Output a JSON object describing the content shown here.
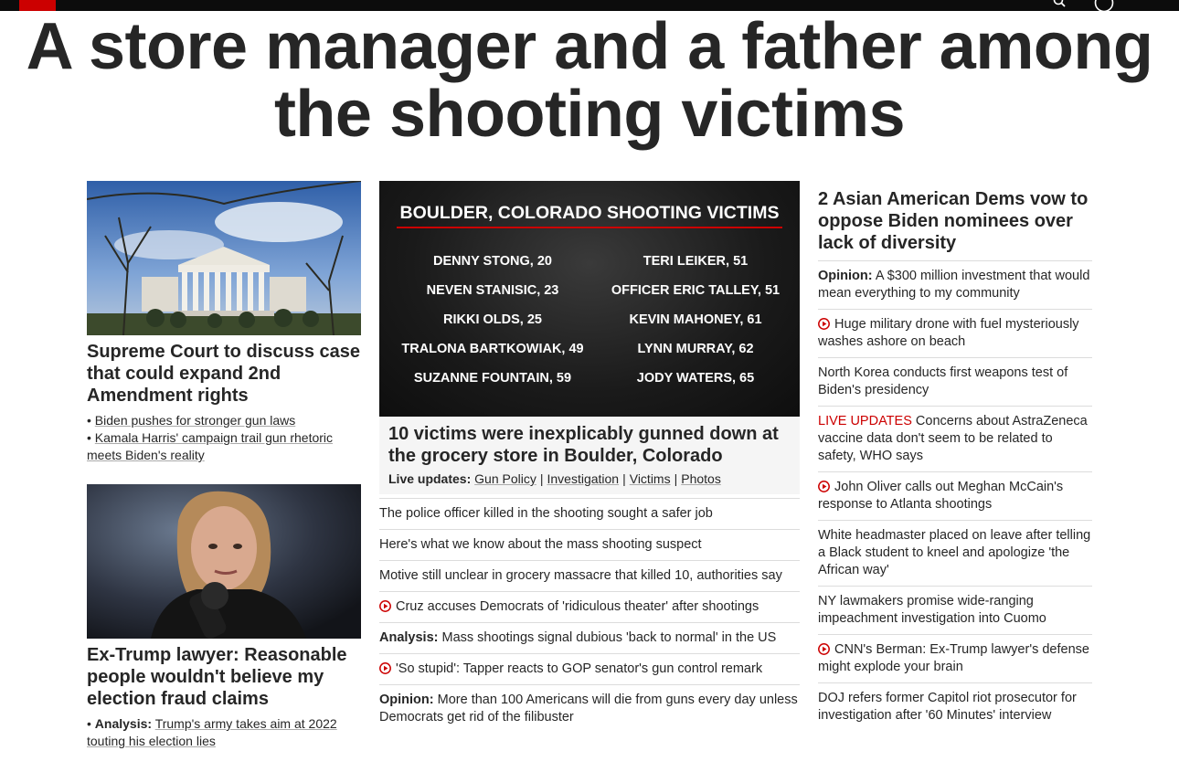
{
  "headline": "A store manager and a father among the shooting victims",
  "left": {
    "story1": {
      "title": "Supreme Court to discuss case that could expand 2nd Amendment rights",
      "links": [
        {
          "prefix": "",
          "text": "Biden pushes for stronger gun laws"
        },
        {
          "prefix": "",
          "text": "Kamala Harris' campaign trail gun rhetoric meets Biden's reality"
        }
      ]
    },
    "story2": {
      "title": "Ex-Trump lawyer: Reasonable people wouldn't believe my election fraud claims",
      "links": [
        {
          "prefix": "Analysis:",
          "text": "Trump's army takes aim at 2022 touting his election lies"
        }
      ]
    }
  },
  "middle": {
    "graphic": {
      "title": "BOULDER, COLORADO SHOOTING VICTIMS",
      "left_names": [
        "DENNY STONG, 20",
        "NEVEN STANISIC, 23",
        "RIKKI OLDS, 25",
        "TRALONA BARTKOWIAK, 49",
        "SUZANNE FOUNTAIN, 59"
      ],
      "right_names": [
        "TERI LEIKER, 51",
        "OFFICER ERIC TALLEY, 51",
        "KEVIN MAHONEY, 61",
        "LYNN MURRAY, 62",
        "JODY WATERS, 65"
      ]
    },
    "lead_title": "10 victims were inexplicably gunned down at the grocery store in Boulder, Colorado",
    "live_label": "Live updates:",
    "live_links": [
      "Gun Policy",
      "Investigation",
      "Victims",
      "Photos"
    ],
    "list": [
      {
        "prefix": "",
        "video": false,
        "text": "The police officer killed in the shooting sought a safer job"
      },
      {
        "prefix": "",
        "video": false,
        "text": "Here's what we know about the mass shooting suspect"
      },
      {
        "prefix": "",
        "video": false,
        "text": "Motive still unclear in grocery massacre that killed 10, authorities say"
      },
      {
        "prefix": "",
        "video": true,
        "text": "Cruz accuses Democrats of 'ridiculous theater' after shootings"
      },
      {
        "prefix": "Analysis:",
        "video": false,
        "text": "Mass shootings signal dubious 'back to normal' in the US"
      },
      {
        "prefix": "",
        "video": true,
        "text": "'So stupid': Tapper reacts to GOP senator's gun control remark"
      },
      {
        "prefix": "Opinion:",
        "video": false,
        "text": "More than 100 Americans will die from guns every day unless Democrats get rid of the filibuster"
      }
    ]
  },
  "right": {
    "title": "2 Asian American Dems vow to oppose Biden nominees over lack of diversity",
    "list": [
      {
        "prefix": "Opinion:",
        "video": false,
        "text": "A $300 million investment that would mean everything to my community"
      },
      {
        "prefix": "",
        "video": true,
        "text": "Huge military drone with fuel mysteriously washes ashore on beach"
      },
      {
        "prefix": "",
        "video": false,
        "text": "North Korea conducts first weapons test of Biden's presidency"
      },
      {
        "prefix": "LIVE UPDATES",
        "video": false,
        "text": "Concerns about AstraZeneca vaccine data don't seem to be related to safety, WHO says"
      },
      {
        "prefix": "",
        "video": true,
        "text": "John Oliver calls out Meghan McCain's response to Atlanta shootings"
      },
      {
        "prefix": "",
        "video": false,
        "text": "White headmaster placed on leave after telling a Black student to kneel and apologize 'the African way'"
      },
      {
        "prefix": "",
        "video": false,
        "text": "NY lawmakers promise wide-ranging impeachment investigation into Cuomo"
      },
      {
        "prefix": "",
        "video": true,
        "text": "CNN's Berman: Ex-Trump lawyer's defense might explode your brain"
      },
      {
        "prefix": "",
        "video": false,
        "text": "DOJ refers former Capitol riot prosecutor for investigation after '60 Minutes' interview"
      }
    ]
  },
  "colors": {
    "brand_red": "#cc0000",
    "text": "#262626",
    "divider": "#dcdcdc",
    "topbar": "#0c0c0c"
  }
}
